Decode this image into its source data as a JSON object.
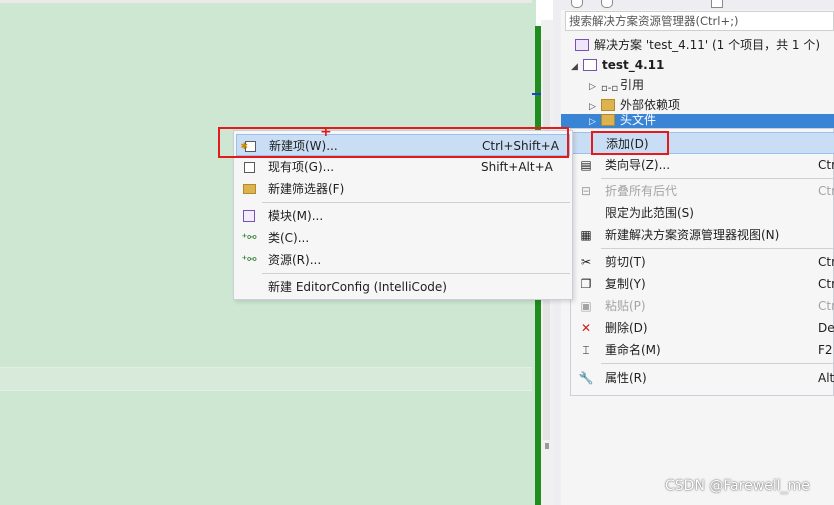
{
  "solution_explorer": {
    "search_placeholder": "搜索解决方案资源管理器(Ctrl+;)",
    "tree": {
      "solution": "解决方案 'test_4.11' (1 个项目，共 1 个)",
      "project": "test_4.11",
      "references": "引用",
      "external_deps": "外部依赖项",
      "header_files": "头文件"
    }
  },
  "context_menu_right": {
    "items": [
      {
        "label": "添加(D)",
        "shortcut": ""
      },
      {
        "label": "类向导(Z)...",
        "shortcut": "Ctr"
      },
      {
        "label": "折叠所有后代",
        "shortcut": "Ctr"
      },
      {
        "label": "限定为此范围(S)",
        "shortcut": ""
      },
      {
        "label": "新建解决方案资源管理器视图(N)",
        "shortcut": ""
      },
      {
        "label": "剪切(T)",
        "shortcut": "Ctr"
      },
      {
        "label": "复制(Y)",
        "shortcut": "Ctr"
      },
      {
        "label": "粘贴(P)",
        "shortcut": "Ctr"
      },
      {
        "label": "删除(D)",
        "shortcut": "De"
      },
      {
        "label": "重命名(M)",
        "shortcut": "F2"
      },
      {
        "label": "属性(R)",
        "shortcut": "Alt"
      }
    ]
  },
  "submenu_add": {
    "items": [
      {
        "label": "新建项(W)...",
        "shortcut": "Ctrl+Shift+A"
      },
      {
        "label": "现有项(G)...",
        "shortcut": "Shift+Alt+A"
      },
      {
        "label": "新建筛选器(F)",
        "shortcut": ""
      },
      {
        "label": "模块(M)...",
        "shortcut": ""
      },
      {
        "label": "类(C)...",
        "shortcut": ""
      },
      {
        "label": "资源(R)...",
        "shortcut": ""
      },
      {
        "label": "新建 EditorConfig (IntelliCode)",
        "shortcut": ""
      }
    ]
  },
  "annotation": {
    "plus": "+"
  },
  "watermark": "CSDN @Farewell_me",
  "colors": {
    "highlight_border": "#e31b1b",
    "selection": "#3a84d6",
    "editor_bg": "#cde7d2",
    "git_bar": "#1e8c1e"
  }
}
